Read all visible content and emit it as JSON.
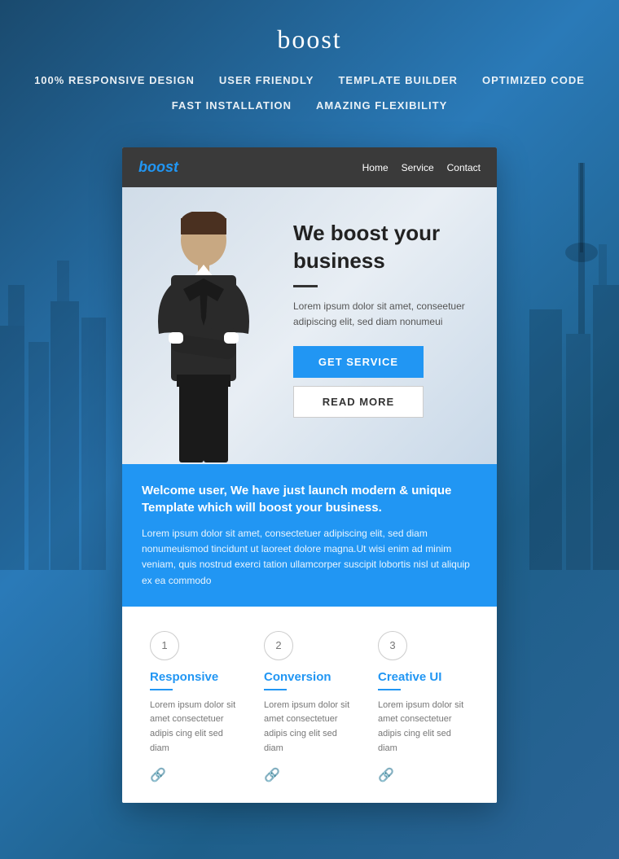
{
  "header": {
    "brand": "boost",
    "features": [
      "100% RESPONSIVE DESIGN",
      "USER FRIENDLY",
      "TEMPLATE BUILDER",
      "OPTIMIZED CODE",
      "FAST INSTALLATION",
      "AMAZING FLEXIBILITY"
    ]
  },
  "nav": {
    "brand": "boost",
    "links": [
      "Home",
      "Service",
      "Contact"
    ]
  },
  "hero": {
    "title": "We boost your business",
    "body": "Lorem ipsum dolor sit amet, conseetuer adipiscing elit, sed diam nonumeui",
    "btn_primary": "GET SERVICE",
    "btn_secondary": "READ MORE"
  },
  "welcome": {
    "title": "Welcome user, We have just launch modern & unique Template which will boost your business.",
    "body": "Lorem ipsum dolor sit amet, consectetuer adipiscing elit, sed diam nonumeuismod tincidunt ut laoreet dolore magna.Ut wisi enim ad minim veniam, quis nostrud exerci tation ullamcorper suscipit lobortis nisl ut aliquip ex ea commodo"
  },
  "features": [
    {
      "number": "1",
      "title": "Responsive",
      "desc": "Lorem ipsum dolor sit amet consectetuer adipis cing elit sed diam"
    },
    {
      "number": "2",
      "title": "Conversion",
      "desc": "Lorem ipsum dolor sit amet consectetuer adipis cing elit sed diam"
    },
    {
      "number": "3",
      "title": "Creative UI",
      "desc": "Lorem ipsum dolor sit amet consectetuer adipis cing elit sed diam"
    }
  ]
}
